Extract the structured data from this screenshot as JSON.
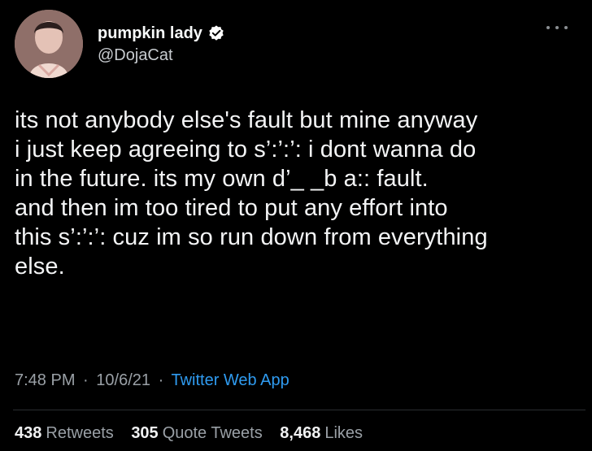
{
  "tweet": {
    "author": {
      "display_name": "pumpkin lady",
      "handle": "@DojaCat",
      "verified_icon": "verified-badge-icon",
      "avatar": "profile-photo"
    },
    "more_icon": "more-options-icon",
    "text_lines": [
      "its not anybody else's fault but mine anyway",
      "i just keep agreeing to s’:’:’: i dont wanna do",
      "in the future. its my own d’_ _b a:: fault.",
      "and then im too tired to put any effort into",
      "this s’:’:’: cuz im so run down from everything",
      "else."
    ],
    "time": "7:48 PM",
    "date": "10/6/21",
    "separator": "·",
    "source": "Twitter Web App",
    "stats": {
      "retweets_count": "438",
      "retweets_label": "Retweets",
      "quotes_count": "305",
      "quotes_label": "Quote Tweets",
      "likes_count": "8,468",
      "likes_label": "Likes"
    },
    "colors": {
      "background": "#000000",
      "text": "#f3f4f5",
      "muted": "#9aa0a6",
      "link": "#2f9bf0",
      "verified": "#ffffff"
    }
  }
}
